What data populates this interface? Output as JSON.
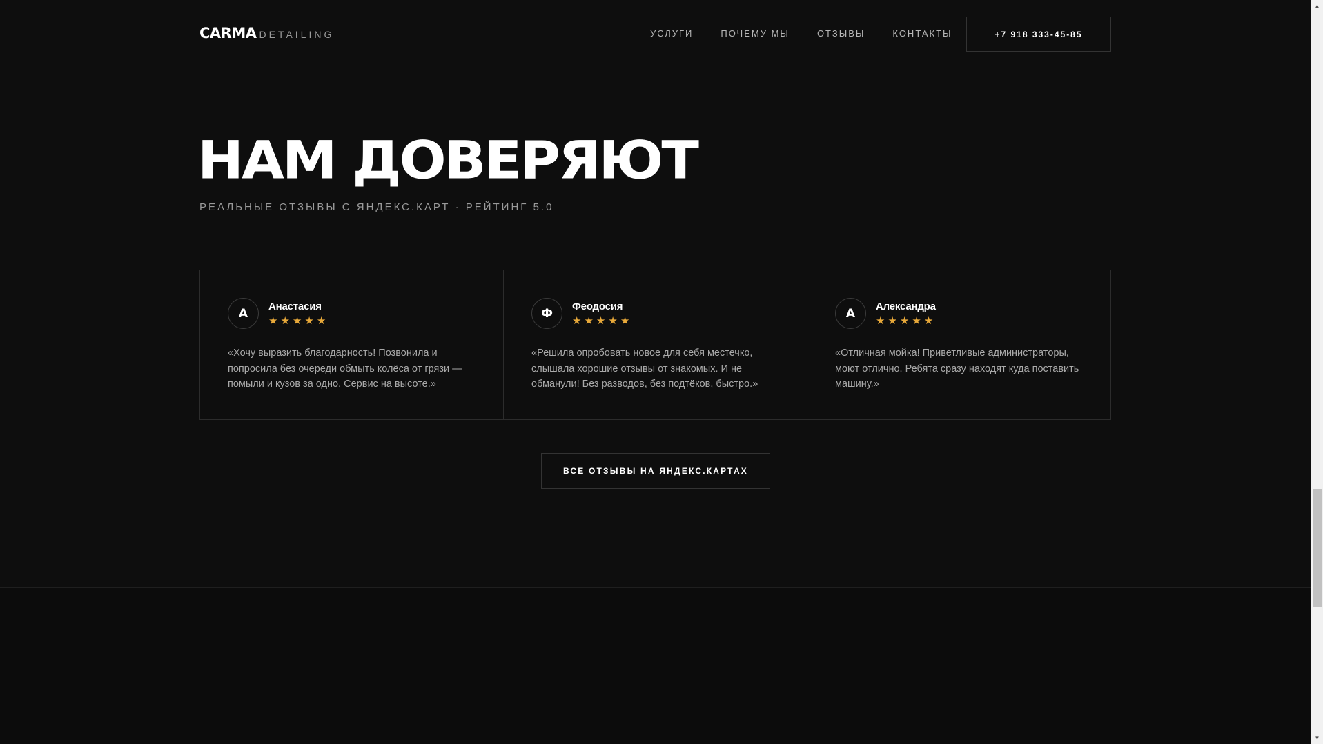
{
  "header": {
    "logo_main": "CARMA",
    "logo_sub": "DETAILING",
    "nav": [
      "УСЛУГИ",
      "ПОЧЕМУ МЫ",
      "ОТЗЫВЫ",
      "КОНТАКТЫ"
    ],
    "phone": "+7 918 333-45-85"
  },
  "hero": {
    "title": "НАМ ДОВЕРЯЮТ",
    "subtitle": "РЕАЛЬНЫЕ ОТЗЫВЫ С ЯНДЕКС.КАРТ · РЕЙТИНГ 5.0"
  },
  "reviews": [
    {
      "initial": "А",
      "name": "Анастасия",
      "rating": 5,
      "text": "«Хочу выразить благодарность! Позвонила и попросила без очереди обмыть колёса от грязи — помыли и кузов за одно. Сервис на высоте.»"
    },
    {
      "initial": "Ф",
      "name": "Феодосия",
      "rating": 5,
      "text": "«Решила опробовать новое для себя местечко, слышала хорошие отзывы от знакомых. И не обманули! Без разводов, без подтёков, быстро.»"
    },
    {
      "initial": "А",
      "name": "Александра",
      "rating": 5,
      "text": "«Отличная мойка! Приветливые администраторы, моют отлично. Ребята сразу находят куда поставить машину.»"
    }
  ],
  "all_reviews_button": "ВСЕ ОТЗЫВЫ НА ЯНДЕКС.КАРТАХ",
  "colors": {
    "background": "#0e0e0e",
    "star": "#e8a93a",
    "border": "#2c2c2c"
  },
  "icons": {
    "star": "star-icon",
    "scroll_up": "chevron-up-icon",
    "scroll_down": "chevron-down-icon"
  }
}
